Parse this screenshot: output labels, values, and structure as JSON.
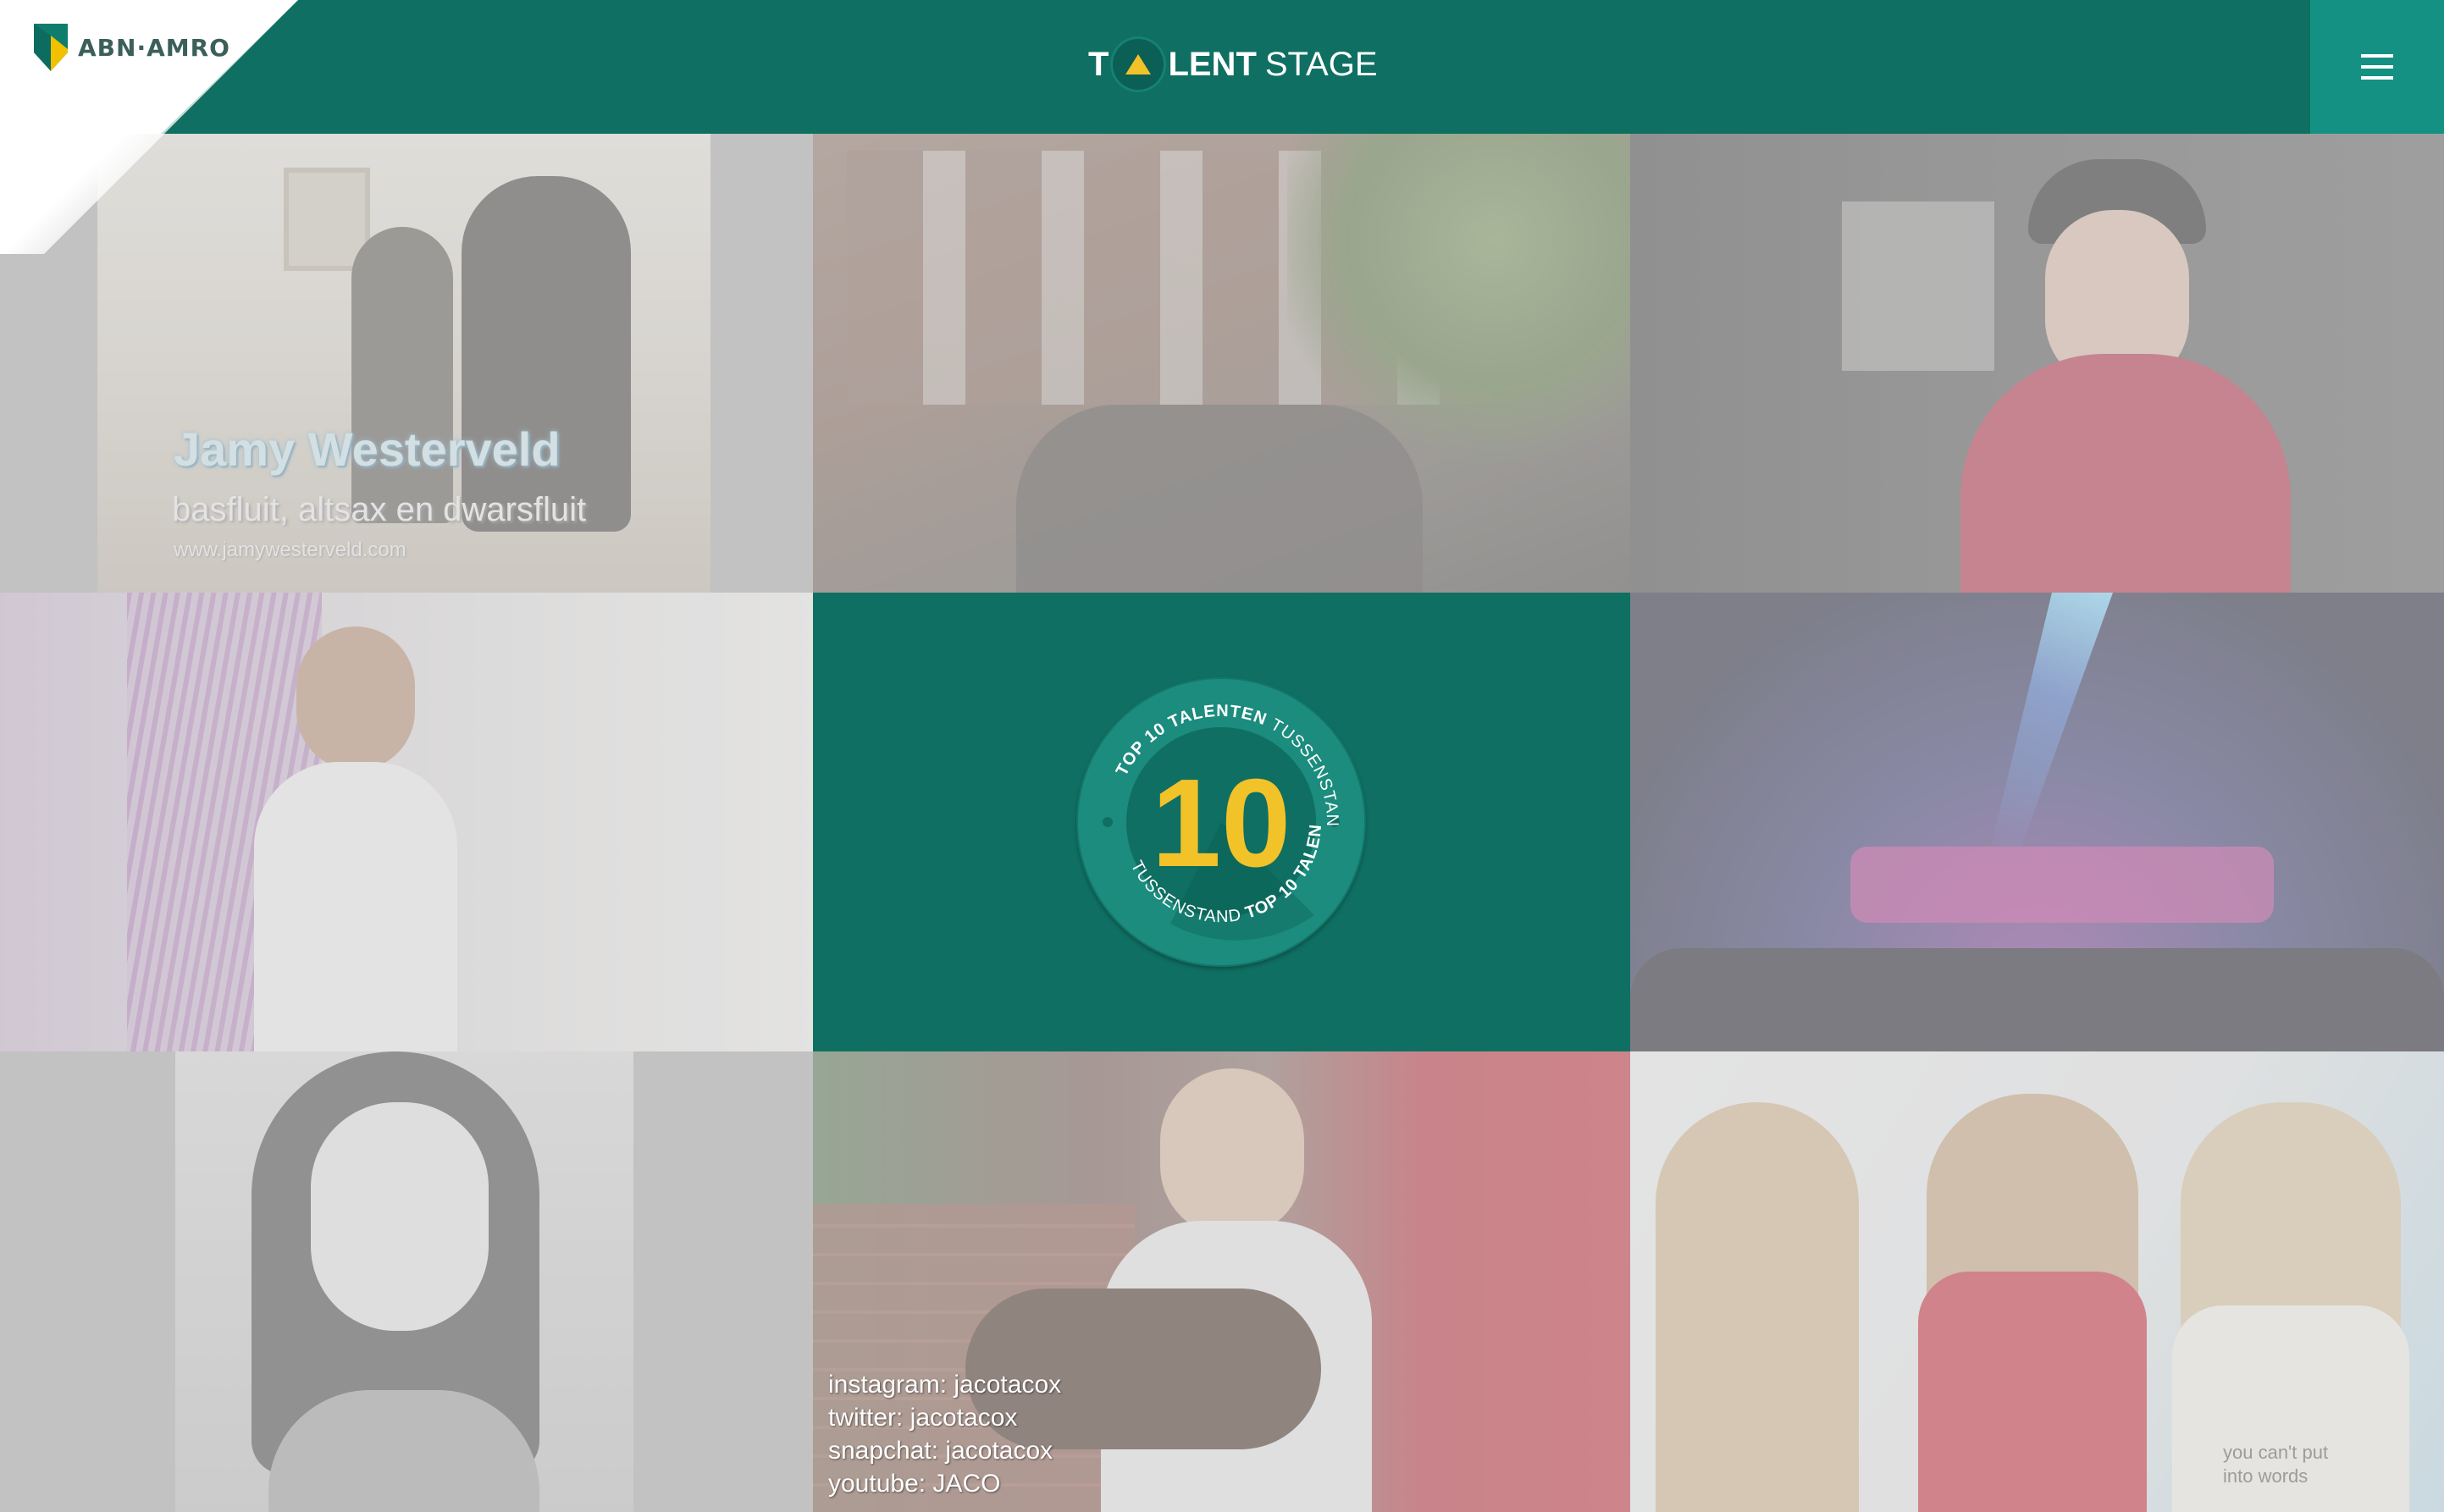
{
  "brand": {
    "bank_name": "ABN·AMRO"
  },
  "header": {
    "logo_t": "T",
    "logo_lent": "LENT",
    "logo_stage": "STAGE"
  },
  "tiles": {
    "tile1": {
      "name": "Jamy Westerveld",
      "instruments": "basfluit, altsax en dwarsfluit",
      "url": "www.jamywesterveld.com"
    },
    "tile8": {
      "instagram": "instagram:  jacotacox",
      "twitter": "twitter:  jacotacox",
      "snapchat": "snapchat:  jacotacox",
      "youtube": "youtube:  JACO"
    },
    "tile9": {
      "shirt_line1": "you can't put",
      "shirt_line2": "into words"
    }
  },
  "badge": {
    "number": "10",
    "ring_top": "TOP 10 TALENTEN",
    "ring_top_light": "TUSSENSTAND",
    "ring_bottom": "TOP 10 TALENTEN",
    "ring_bottom_light": "TUSSENSTAND"
  },
  "colors": {
    "brand_green": "#0f6f62",
    "menu_bg": "#149183",
    "accent_yellow": "#f2c229",
    "abn_shield_yellow": "#f3c000"
  }
}
